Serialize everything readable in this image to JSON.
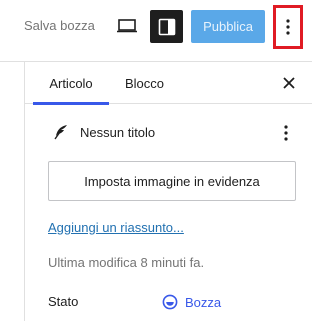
{
  "toolbar": {
    "save_draft_label": "Salva bozza",
    "publish_label": "Pubblica",
    "preview_icon": "laptop-icon",
    "settings_icon": "sidebar-panel-icon",
    "options_icon": "vertical-ellipsis-icon"
  },
  "sidebar": {
    "tabs": [
      {
        "label": "Articolo",
        "active": true
      },
      {
        "label": "Blocco",
        "active": false
      }
    ],
    "close_icon": "close-icon",
    "document": {
      "icon": "feather-pen-icon",
      "title": "Nessun titolo",
      "menu_icon": "vertical-ellipsis-icon"
    },
    "featured_image_button": "Imposta immagine in evidenza",
    "excerpt_link": "Aggiungi un riassunto...",
    "last_modified": "Ultima modifica 8 minuti fa.",
    "status": {
      "label": "Stato",
      "value": "Bozza",
      "icon": "draft-status-icon"
    }
  },
  "colors": {
    "accent": "#3858e9",
    "publish_button": "#5aa8e8",
    "link": "#2271b1",
    "highlight_border": "#e01b24"
  }
}
